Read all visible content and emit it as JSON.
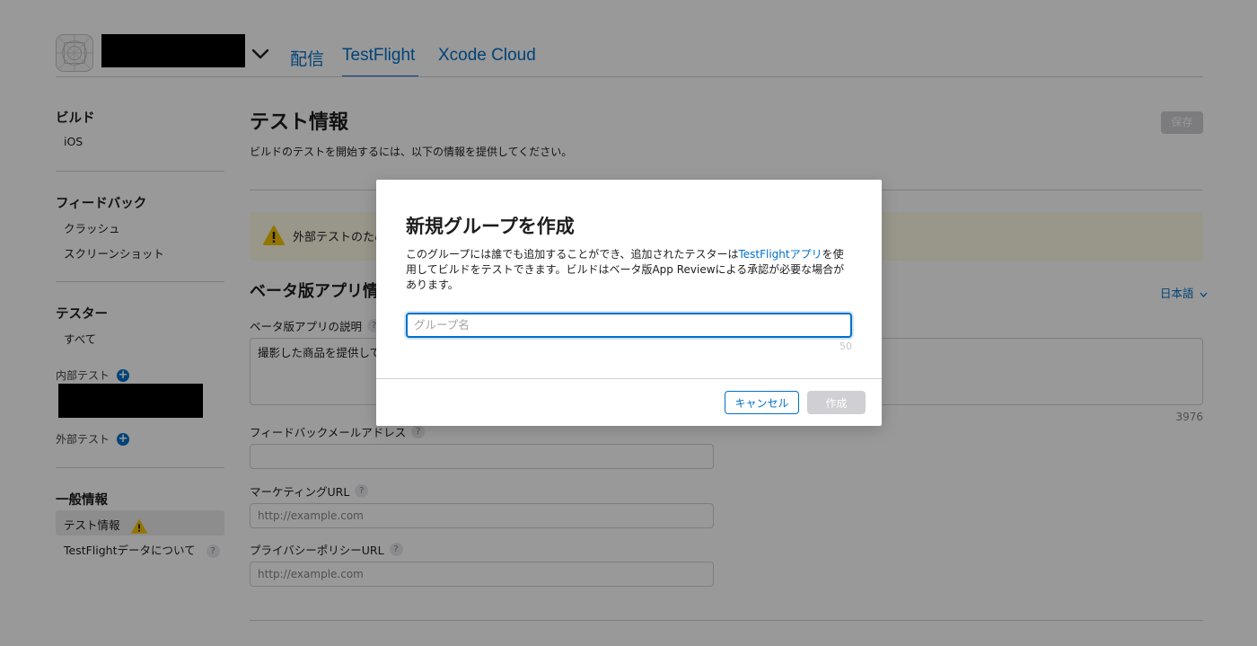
{
  "header": {
    "tabs": [
      {
        "label": "配信"
      },
      {
        "label": "TestFlight"
      },
      {
        "label": "Xcode Cloud"
      }
    ]
  },
  "sidebar": {
    "builds": {
      "heading": "ビルド",
      "items": [
        "iOS"
      ]
    },
    "feedback": {
      "heading": "フィードバック",
      "items": [
        "クラッシュ",
        "スクリーンショット"
      ]
    },
    "testers": {
      "heading": "テスター",
      "items": [
        "すべて"
      ],
      "internal_label": "内部テスト",
      "external_label": "外部テスト"
    },
    "general": {
      "heading": "一般情報",
      "items": [
        "テスト情報",
        "TestFlightデータについて"
      ]
    }
  },
  "main": {
    "title": "テスト情報",
    "subtitle": "ビルドのテストを開始するには、以下の情報を提供してください。",
    "save_label": "保存",
    "warning_text": "外部テストのため",
    "section_title": "ベータ版アプリ情",
    "language": "日本語",
    "fields": {
      "description_label": "ベータ版アプリの説明",
      "description_value": "撮影した商品を提供して",
      "description_count": "3976",
      "feedback_email_label": "フィードバックメールアドレス",
      "marketing_url_label": "マーケティングURL",
      "marketing_url_placeholder": "http://example.com",
      "privacy_url_label": "プライバシーポリシーURL",
      "privacy_url_placeholder": "http://example.com"
    }
  },
  "modal": {
    "title": "新規グループを作成",
    "desc_before": "このグループには誰でも追加することができ、追加されたテスターは",
    "desc_link": "TestFlightアプリ",
    "desc_after": "を使用してビルドをテストできます。ビルドはベータ版App Reviewによる承認が必要な場合があります。",
    "input_placeholder": "グループ名",
    "input_value": "",
    "limit": "50",
    "cancel_label": "キャンセル",
    "create_label": "作成"
  }
}
